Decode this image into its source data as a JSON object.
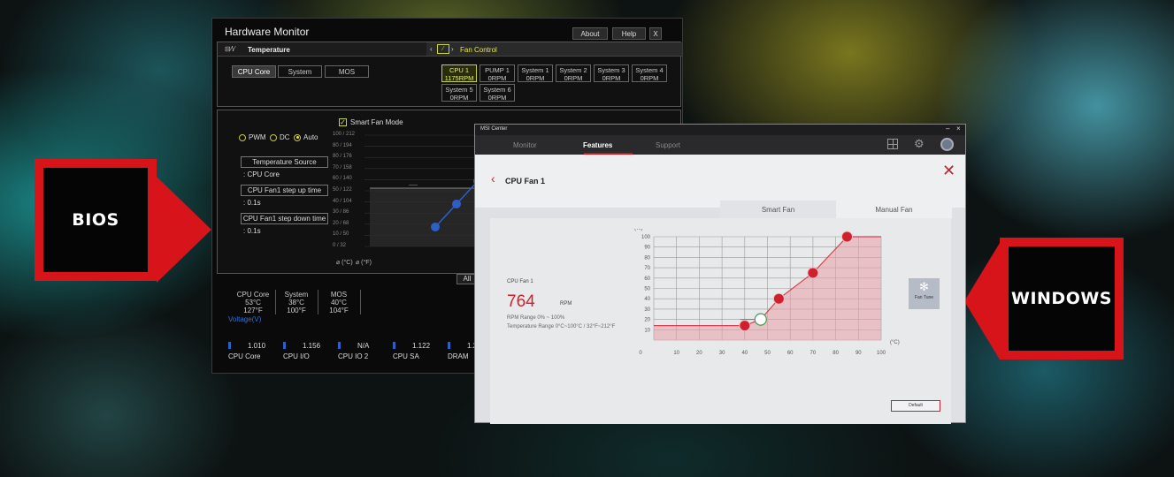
{
  "labels": {
    "bios": "BIOS",
    "windows": "WINDOWS"
  },
  "bios": {
    "title": "Hardware Monitor",
    "buttons": {
      "about": "About",
      "help": "Help",
      "close": "X"
    },
    "temperature_header": "Temperature",
    "fan_control_header": "Fan Control",
    "temp_tabs": [
      "CPU Core",
      "System",
      "MOS"
    ],
    "fans": [
      {
        "name": "CPU 1",
        "rpm": "1175RPM",
        "selected": true
      },
      {
        "name": "PUMP 1",
        "rpm": "0RPM"
      },
      {
        "name": "System 1",
        "rpm": "0RPM"
      },
      {
        "name": "System 2",
        "rpm": "0RPM"
      },
      {
        "name": "System 3",
        "rpm": "0RPM"
      },
      {
        "name": "System 4",
        "rpm": "0RPM"
      },
      {
        "name": "System 5",
        "rpm": "0RPM"
      },
      {
        "name": "System 6",
        "rpm": "0RPM"
      }
    ],
    "modes": {
      "pwm": "PWM",
      "dc": "DC",
      "auto": "Auto",
      "selected": "auto"
    },
    "temp_source_label": "Temperature Source",
    "temp_source_value": ": CPU Core",
    "step_up_label": "CPU Fan1 step up time",
    "step_up_value": ": 0.1s",
    "step_down_label": "CPU Fan1 step down time",
    "step_down_value": ": 0.1s",
    "smart_fan_mode": "Smart Fan Mode",
    "y_ticks": [
      "100 / 212",
      "80 / 194",
      "80 / 176",
      "70 / 158",
      "60 / 140",
      "50 / 122",
      "40 / 104",
      "30 / 86",
      "20 / 68",
      "10 / 50",
      "0 / 32"
    ],
    "unit_c": "(°C)",
    "unit_f": "(°F)",
    "all_button": "All",
    "stats": [
      {
        "name": "CPU Core",
        "c": "53°C",
        "f": "127°F"
      },
      {
        "name": "System",
        "c": "38°C",
        "f": "100°F"
      },
      {
        "name": "MOS",
        "c": "40°C",
        "f": "104°F"
      }
    ],
    "voltage_label": "Voltage(V)",
    "voltages": [
      {
        "name": "CPU Core",
        "value": "1.010"
      },
      {
        "name": "CPU I/O",
        "value": "1.156"
      },
      {
        "name": "CPU IO 2",
        "value": "N/A"
      },
      {
        "name": "CPU SA",
        "value": "1.122"
      },
      {
        "name": "DRAM",
        "value": "1.2"
      }
    ]
  },
  "msi": {
    "app_title": "MSI Center",
    "nav_tabs": [
      "Monitor",
      "Features",
      "Support"
    ],
    "active_nav": "Features",
    "page_title": "CPU Fan 1",
    "tabs": [
      "Smart Fan",
      "Manual Fan"
    ],
    "fan_name": "CPU Fan 1",
    "rpm_value": "764",
    "rpm_unit": "RPM",
    "rpm_range": "RPM Range  0% ~ 100%",
    "temp_range": "Temperature Range  0°C~100°C / 32°F~212°F",
    "fan_tune": "Fan Tune",
    "default_button": "Default",
    "y_label": "(%)",
    "x_unit": "(°C)",
    "x_ticks": [
      "0",
      "10",
      "20",
      "30",
      "40",
      "50",
      "60",
      "70",
      "80",
      "90",
      "100"
    ],
    "y_ticks": [
      "100",
      "90",
      "80",
      "70",
      "60",
      "50",
      "40",
      "30",
      "20",
      "10"
    ]
  },
  "colors": {
    "accent_red": "#d8141b",
    "curve_red": "#c8202e",
    "bios_yellow": "#c8d23c",
    "bios_blue": "#2d5fc8"
  }
}
